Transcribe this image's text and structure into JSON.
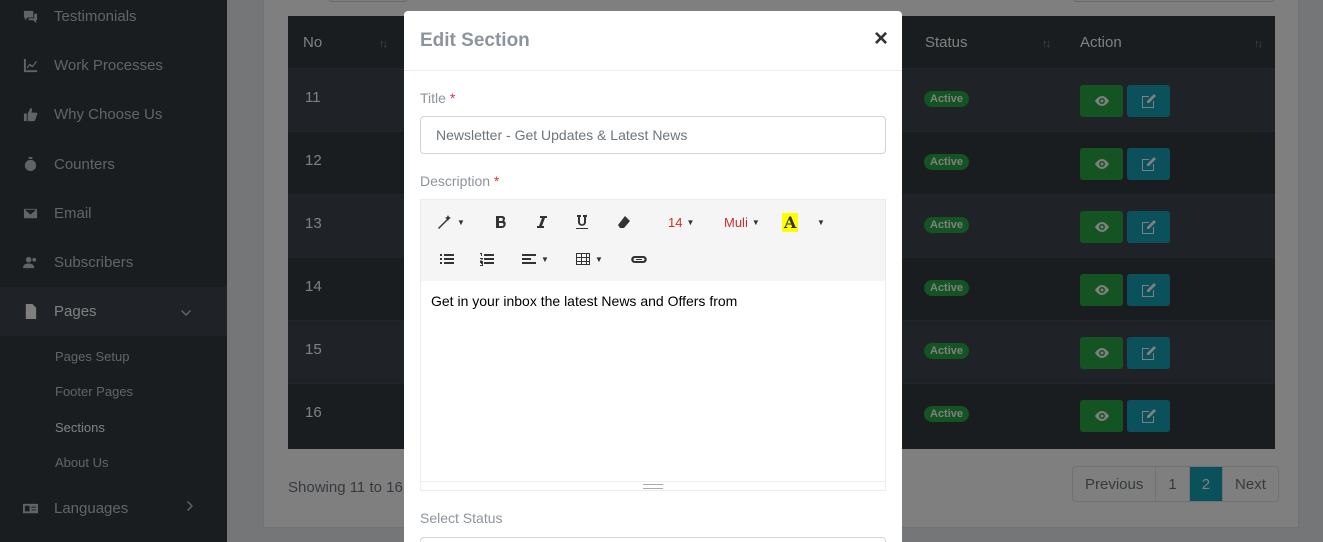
{
  "sidebar": {
    "items": [
      {
        "label": "Testimonials",
        "icon": "comments-icon"
      },
      {
        "label": "Work Processes",
        "icon": "chart-line-icon"
      },
      {
        "label": "Why Choose Us",
        "icon": "thumbs-up-icon"
      },
      {
        "label": "Counters",
        "icon": "stopwatch-icon"
      },
      {
        "label": "Email",
        "icon": "envelope-icon"
      },
      {
        "label": "Subscribers",
        "icon": "users-icon"
      },
      {
        "label": "Pages",
        "icon": "file-icon"
      },
      {
        "label": "Languages",
        "icon": "language-icon"
      }
    ],
    "sub_items": [
      {
        "label": "Pages Setup"
      },
      {
        "label": "Footer Pages"
      },
      {
        "label": "Sections"
      },
      {
        "label": "About Us"
      }
    ]
  },
  "table": {
    "headers": {
      "no": "No",
      "status": "Status",
      "action": "Action"
    },
    "rows": [
      {
        "no": "11",
        "status": "Active"
      },
      {
        "no": "12",
        "status": "Active"
      },
      {
        "no": "13",
        "status": "Active"
      },
      {
        "no": "14",
        "status": "Active"
      },
      {
        "no": "15",
        "status": "Active"
      },
      {
        "no": "16",
        "status": "Active"
      }
    ],
    "showing": "Showing 11 to 16",
    "pagination": {
      "previous": "Previous",
      "page1": "1",
      "page2": "2",
      "next": "Next"
    }
  },
  "modal": {
    "title": "Edit Section",
    "close": "×",
    "title_label": "Title",
    "required_mark": "*",
    "title_placeholder": "Newsletter - Get Updates & Latest News",
    "description_label": "Description",
    "toolbar": {
      "font_size": "14",
      "font_name": "Muli",
      "color_letter": "A"
    },
    "description_text": "Get in your inbox the latest News and Offers from",
    "select_status_label": "Select Status"
  },
  "colors": {
    "sidebar_bg": "#343a40",
    "accent": "#17a2b8",
    "success": "#28a745"
  }
}
